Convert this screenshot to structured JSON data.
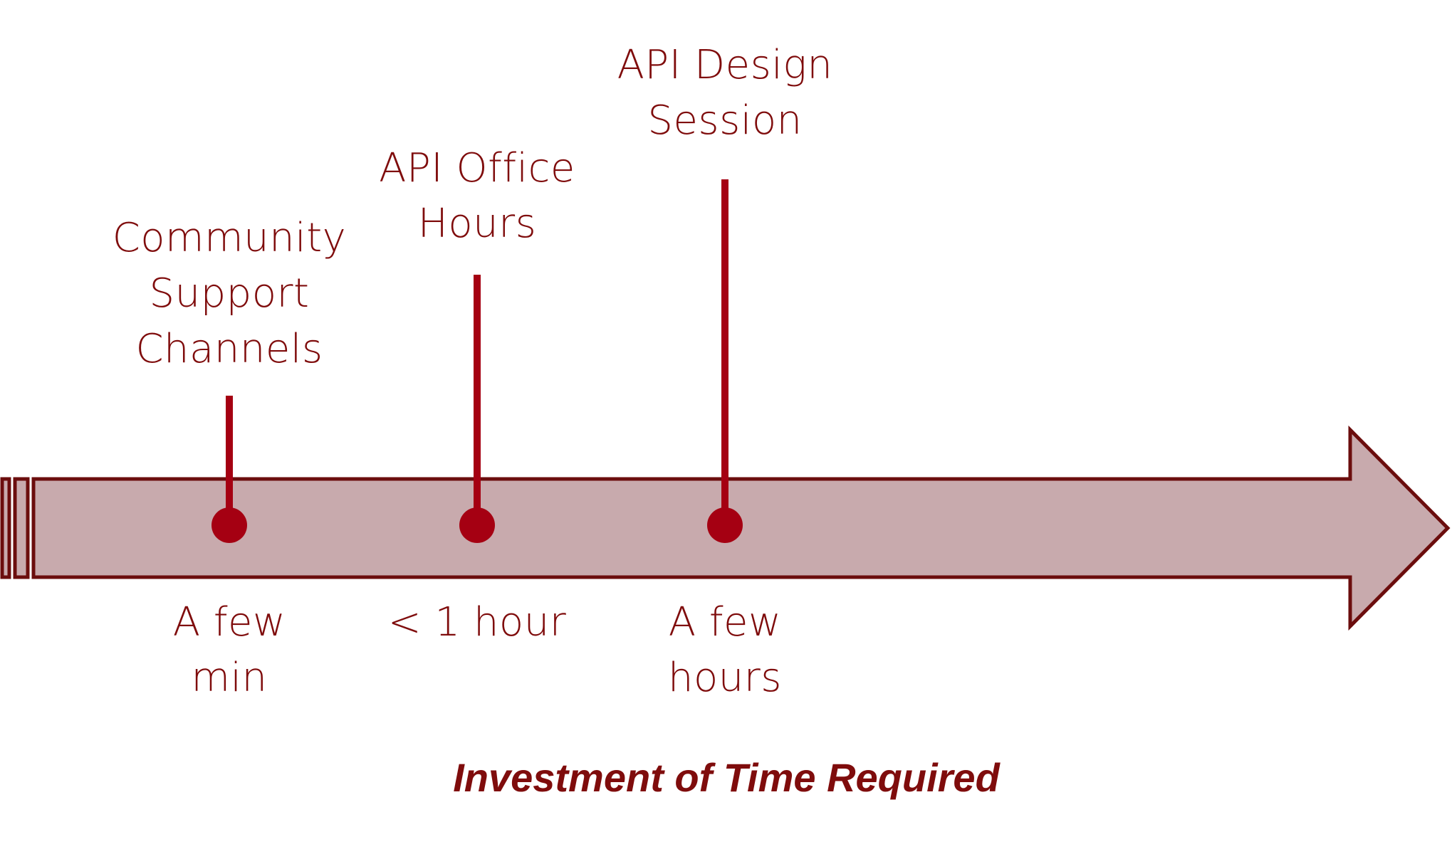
{
  "colors": {
    "arrow_fill": "#c8aaad",
    "arrow_border": "#6b0d0d",
    "marker": "#a50012",
    "text": "#7f0c0c"
  },
  "chart_data": {
    "type": "timeline",
    "title": "Investment of Time Required",
    "axis_direction": "left-to-right",
    "milestones": [
      {
        "name": "Community Support Channels",
        "name_lines": [
          "Community",
          "Support",
          "Channels"
        ],
        "time": "A few min",
        "time_lines": [
          "A few",
          "min"
        ],
        "order": 1
      },
      {
        "name": "API Office Hours",
        "name_lines": [
          "API Office",
          "Hours"
        ],
        "time": "< 1 hour",
        "time_lines": [
          "< 1 hour"
        ],
        "order": 2
      },
      {
        "name": "API Design Session",
        "name_lines": [
          "API Design",
          "Session"
        ],
        "time": "A few hours",
        "time_lines": [
          "A few",
          "hours"
        ],
        "order": 3
      }
    ]
  }
}
